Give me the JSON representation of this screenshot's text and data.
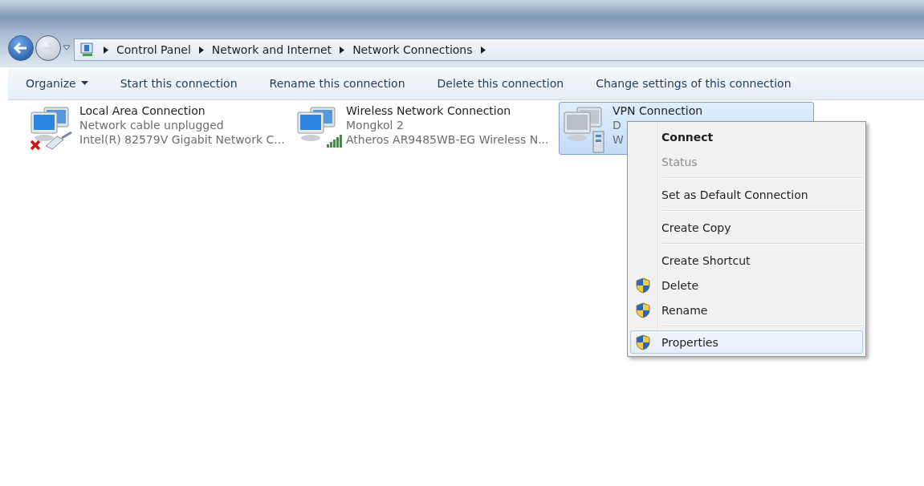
{
  "breadcrumb": [
    "Control Panel",
    "Network and Internet",
    "Network Connections"
  ],
  "toolbar": [
    {
      "label": "Organize",
      "dropdown": true
    },
    {
      "label": "Start this connection",
      "dropdown": false
    },
    {
      "label": "Rename this connection",
      "dropdown": false
    },
    {
      "label": "Delete this connection",
      "dropdown": false
    },
    {
      "label": "Change settings of this connection",
      "dropdown": false
    }
  ],
  "connections": [
    {
      "kind": "unplugged",
      "name": "Local Area Connection",
      "status": "Network cable unplugged",
      "device": "Intel(R) 82579V Gigabit Network C...",
      "selected": false
    },
    {
      "kind": "wireless",
      "name": "Wireless Network Connection",
      "status": "Mongkol  2",
      "device": "Atheros AR9485WB-EG Wireless N...",
      "selected": false
    },
    {
      "kind": "vpn",
      "name": "VPN Connection",
      "status": "D",
      "device": "W",
      "selected": true
    }
  ],
  "context_menu": [
    {
      "kind": "item",
      "label": "Connect",
      "bold": true,
      "disabled": false,
      "shield": false,
      "selected": false
    },
    {
      "kind": "item",
      "label": "Status",
      "bold": false,
      "disabled": true,
      "shield": false,
      "selected": false
    },
    {
      "kind": "separator"
    },
    {
      "kind": "item",
      "label": "Set as Default Connection",
      "bold": false,
      "disabled": false,
      "shield": false,
      "selected": false
    },
    {
      "kind": "separator"
    },
    {
      "kind": "item",
      "label": "Create Copy",
      "bold": false,
      "disabled": false,
      "shield": false,
      "selected": false
    },
    {
      "kind": "separator"
    },
    {
      "kind": "item",
      "label": "Create Shortcut",
      "bold": false,
      "disabled": false,
      "shield": false,
      "selected": false
    },
    {
      "kind": "item",
      "label": "Delete",
      "bold": false,
      "disabled": false,
      "shield": true,
      "selected": false
    },
    {
      "kind": "item",
      "label": "Rename",
      "bold": false,
      "disabled": false,
      "shield": true,
      "selected": false
    },
    {
      "kind": "separator"
    },
    {
      "kind": "item",
      "label": "Properties",
      "bold": false,
      "disabled": false,
      "shield": true,
      "selected": true
    }
  ]
}
